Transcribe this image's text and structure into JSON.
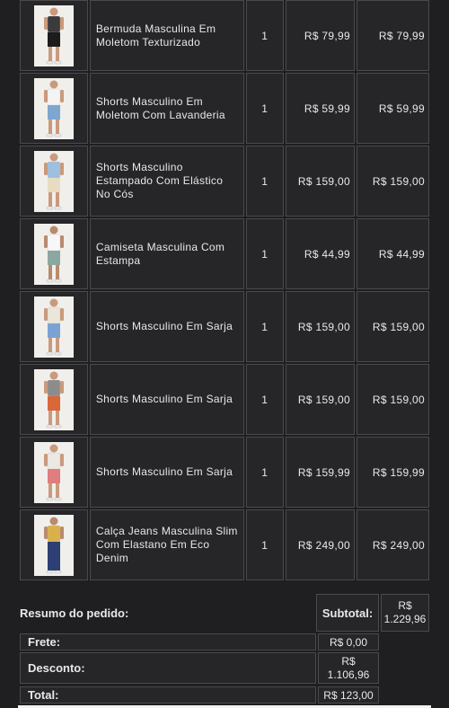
{
  "items": [
    {
      "name": "Bermuda Masculina Em Moletom Texturizado",
      "qty": "1",
      "price": "R$ 79,99",
      "total": "R$ 79,99",
      "image": "product-photo-bermuda-black"
    },
    {
      "name": "Shorts Masculino Em Moletom Com Lavanderia",
      "qty": "1",
      "price": "R$ 59,99",
      "total": "R$ 59,99",
      "image": "product-photo-shorts-lightblue"
    },
    {
      "name": "Shorts Masculino Estampado Com Elástico No Cós",
      "qty": "1",
      "price": "R$ 159,00",
      "total": "R$ 159,00",
      "image": "product-photo-shorts-beige"
    },
    {
      "name": "Camiseta Masculina Com Estampa",
      "qty": "1",
      "price": "R$ 44,99",
      "total": "R$ 44,99",
      "image": "product-photo-tshirt-white"
    },
    {
      "name": "Shorts Masculino Em Sarja",
      "qty": "1",
      "price": "R$ 159,00",
      "total": "R$ 159,00",
      "image": "product-photo-shorts-blue"
    },
    {
      "name": "Shorts Masculino Em Sarja",
      "qty": "1",
      "price": "R$ 159,00",
      "total": "R$ 159,00",
      "image": "product-photo-shorts-orange"
    },
    {
      "name": "Shorts Masculino Em Sarja",
      "qty": "1",
      "price": "R$ 159,99",
      "total": "R$ 159,99",
      "image": "product-photo-shorts-pink"
    },
    {
      "name": "Calça Jeans Masculina Slim Com Elastano Em Eco Denim",
      "qty": "1",
      "price": "R$ 249,00",
      "total": "R$ 249,00",
      "image": "product-photo-jeans-blue"
    }
  ],
  "summary": {
    "title": "Resumo do pedido:",
    "subtotal_label": "Subtotal:",
    "subtotal_value_line1": "R$",
    "subtotal_value_line2": "1.229,96",
    "frete_label": "Frete:",
    "frete_value": "R$ 0,00",
    "desconto_label": "Desconto:",
    "desconto_value_line1": "R$",
    "desconto_value_line2": "1.106,96",
    "total_label": "Total:",
    "total_value": "R$ 123,00"
  }
}
